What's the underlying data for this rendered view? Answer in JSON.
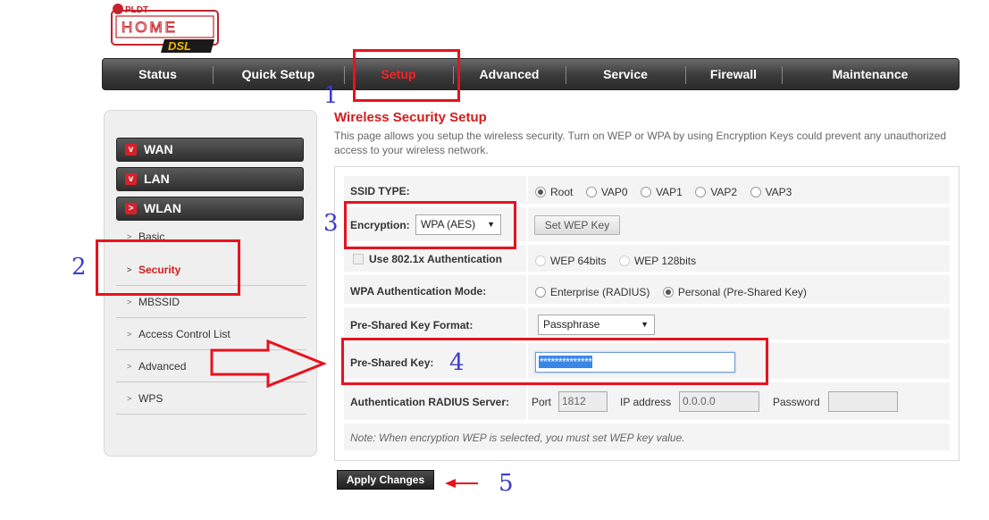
{
  "logo": {
    "brand": "PLDT",
    "line1": "HOME",
    "line2": "DSL"
  },
  "nav": [
    {
      "label": "Status",
      "active": false
    },
    {
      "label": "Quick Setup",
      "active": false
    },
    {
      "label": "Setup",
      "active": true
    },
    {
      "label": "Advanced",
      "active": false
    },
    {
      "label": "Service",
      "active": false
    },
    {
      "label": "Firewall",
      "active": false
    },
    {
      "label": "Maintenance",
      "active": false
    }
  ],
  "sidebar": {
    "groups": [
      "WAN",
      "LAN",
      "WLAN"
    ],
    "wlan_items": [
      "Basic",
      "Security",
      "MBSSID",
      "Access Control List",
      "Advanced",
      "WPS"
    ],
    "active_item": "Security"
  },
  "page": {
    "title": "Wireless Security Setup",
    "description": "This page allows you setup the wireless security. Turn on WEP or WPA by using Encryption Keys could prevent any unauthorized access to your wireless network."
  },
  "form": {
    "ssid_type": {
      "label": "SSID TYPE:",
      "options": [
        "Root",
        "VAP0",
        "VAP1",
        "VAP2",
        "VAP3"
      ],
      "selected": "Root"
    },
    "encryption": {
      "label": "Encryption:",
      "value": "WPA (AES)",
      "wep_button": "Set WEP Key"
    },
    "dot1x": {
      "label": "Use 802.1x Authentication",
      "wep64": "WEP 64bits",
      "wep128": "WEP 128bits"
    },
    "wpa_mode": {
      "label": "WPA Authentication Mode:",
      "enterprise": "Enterprise (RADIUS)",
      "personal": "Personal (Pre-Shared Key)",
      "selected": "Personal (Pre-Shared Key)"
    },
    "psk_format": {
      "label": "Pre-Shared Key Format:",
      "value": "Passphrase"
    },
    "psk": {
      "label": "Pre-Shared Key:",
      "value": "**************"
    },
    "radius": {
      "label": "Authentication RADIUS Server:",
      "port_label": "Port",
      "port": "1812",
      "ip_label": "IP address",
      "ip": "0.0.0.0",
      "pw_label": "Password",
      "pw": ""
    },
    "note": "Note: When encryption WEP is selected, you must set WEP key value."
  },
  "apply_button": "Apply Changes",
  "annotations": [
    "1",
    "2",
    "3",
    "4",
    "5"
  ],
  "colors": {
    "accent_red": "#d41c1c",
    "annotation_red": "#e8121e",
    "annotation_blue": "#3b3bd0"
  }
}
